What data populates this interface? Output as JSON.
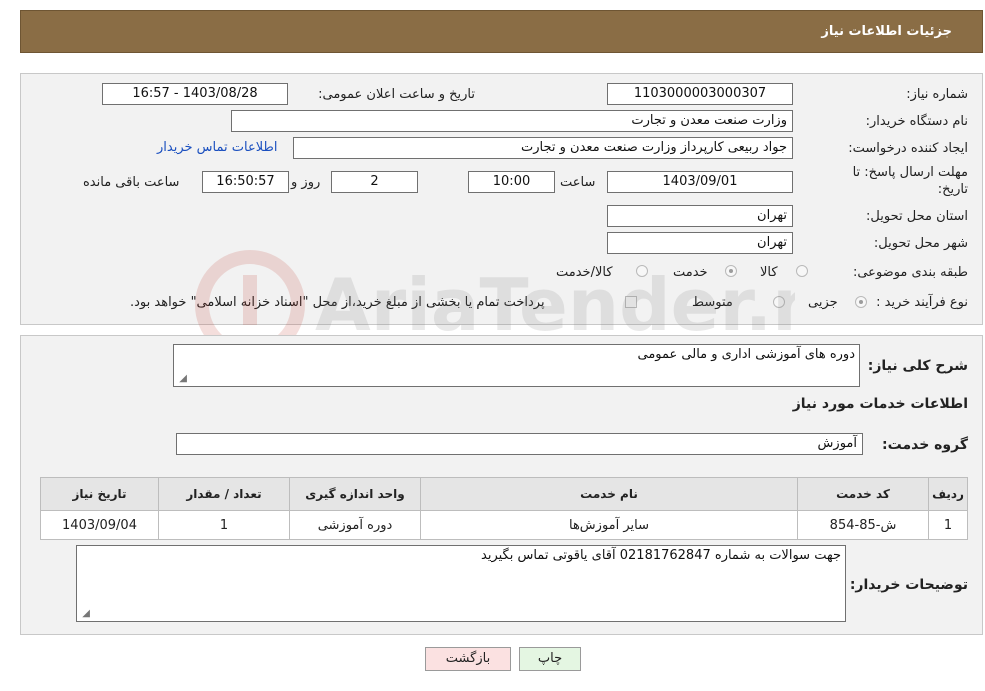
{
  "header": {
    "title": "جزئیات اطلاعات نیاز"
  },
  "form": {
    "need_number": {
      "label": "شماره نیاز:",
      "value": "1103000003000307"
    },
    "announce_datetime": {
      "label": "تاریخ و ساعت اعلان عمومی:",
      "value": "1403/08/28 - 16:57"
    },
    "buyer_org": {
      "label": "نام دستگاه خریدار:",
      "value": "وزارت صنعت معدن و تجارت"
    },
    "requester": {
      "label": "ایجاد کننده درخواست:",
      "value": "جواد ربیعی کارپرداز وزارت صنعت معدن و تجارت"
    },
    "buyer_contact_link": "اطلاعات تماس خریدار",
    "deadline": {
      "label_line1": "مهلت ارسال پاسخ: تا",
      "label_line2": "تاریخ:",
      "date": "1403/09/01",
      "time_label": "ساعت",
      "time": "10:00",
      "days": "2",
      "days_label": "روز و",
      "remaining": "16:50:57",
      "remaining_label": "ساعت باقی مانده"
    },
    "delivery_province": {
      "label": "استان محل تحویل:",
      "value": "تهران"
    },
    "delivery_city": {
      "label": "شهر محل تحویل:",
      "value": "تهران"
    },
    "subject_category": {
      "label": "طبقه بندی موضوعی:",
      "options": [
        {
          "label": "کالا",
          "checked": false
        },
        {
          "label": "خدمت",
          "checked": true
        },
        {
          "label": "کالا/خدمت",
          "checked": false
        }
      ]
    },
    "purchase_process": {
      "label": "نوع فرآیند خرید :",
      "options": [
        {
          "label": "جزیی",
          "checked": true
        },
        {
          "label": "متوسط",
          "checked": false
        }
      ],
      "note_checkbox": false,
      "note": "پرداخت تمام یا بخشی از مبلغ خرید،از محل \"اسناد خزانه اسلامی\" خواهد بود."
    }
  },
  "details": {
    "summary_label": "شرح کلی نیاز:",
    "summary_value": "دوره های آموزشی اداری و مالی عمومی",
    "services_title": "اطلاعات خدمات مورد نیاز",
    "service_group_label": "گروه خدمت:",
    "service_group_value": "آموزش",
    "table": {
      "headers": [
        "ردیف",
        "کد خدمت",
        "نام خدمت",
        "واحد اندازه گیری",
        "تعداد / مقدار",
        "تاریخ نیاز"
      ],
      "rows": [
        [
          "1",
          "ش-85-854",
          "سایر آموزش‌ها",
          "دوره آموزشی",
          "1",
          "1403/09/04"
        ]
      ]
    },
    "buyer_notes_label": "توضیحات خریدار:",
    "buyer_notes_value": "جهت سوالات به شماره 02181762847  آقای یاقوتی تماس بگیرید"
  },
  "buttons": {
    "print": "چاپ",
    "back": "بازگشت"
  },
  "watermark": "AriaTender.neT",
  "colors": {
    "header_bg": "#8a6d45",
    "link": "#1a4fbf",
    "back_button_bg": "#fbe1e1",
    "print_button_bg": "#e4f6e2"
  }
}
